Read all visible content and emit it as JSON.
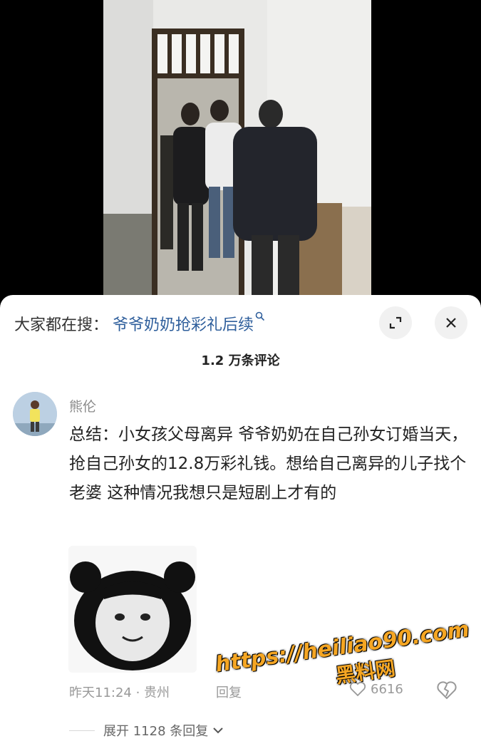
{
  "search": {
    "label": "大家都在搜：",
    "term": "爷爷奶奶抢彩礼后续"
  },
  "comments_header": {
    "title": "1.2 万条评论"
  },
  "comment": {
    "username": "熊伦",
    "text": "总结：小女孩父母离异 爷爷奶奶在自己孙女订婚当天，抢自己孙女的12.8万彩礼钱。想给自己离异的儿子找个老婆  这种情况我想只是短剧上才有的",
    "time": "昨天11:24",
    "location": "贵州",
    "reply_label": "回复",
    "like_count": "6616",
    "expand_label": "展开 1128 条回复"
  },
  "watermark": {
    "url": "https://heiliao90.com",
    "name": "黑料网"
  },
  "icons": {
    "search": "search-icon",
    "expand": "expand-icon",
    "close": "close-icon",
    "like": "heart-icon",
    "dislike": "broken-heart-icon",
    "chevron": "chevron-down-icon"
  },
  "colors": {
    "link": "#2f5f9c",
    "watermark": "#f5a623"
  }
}
